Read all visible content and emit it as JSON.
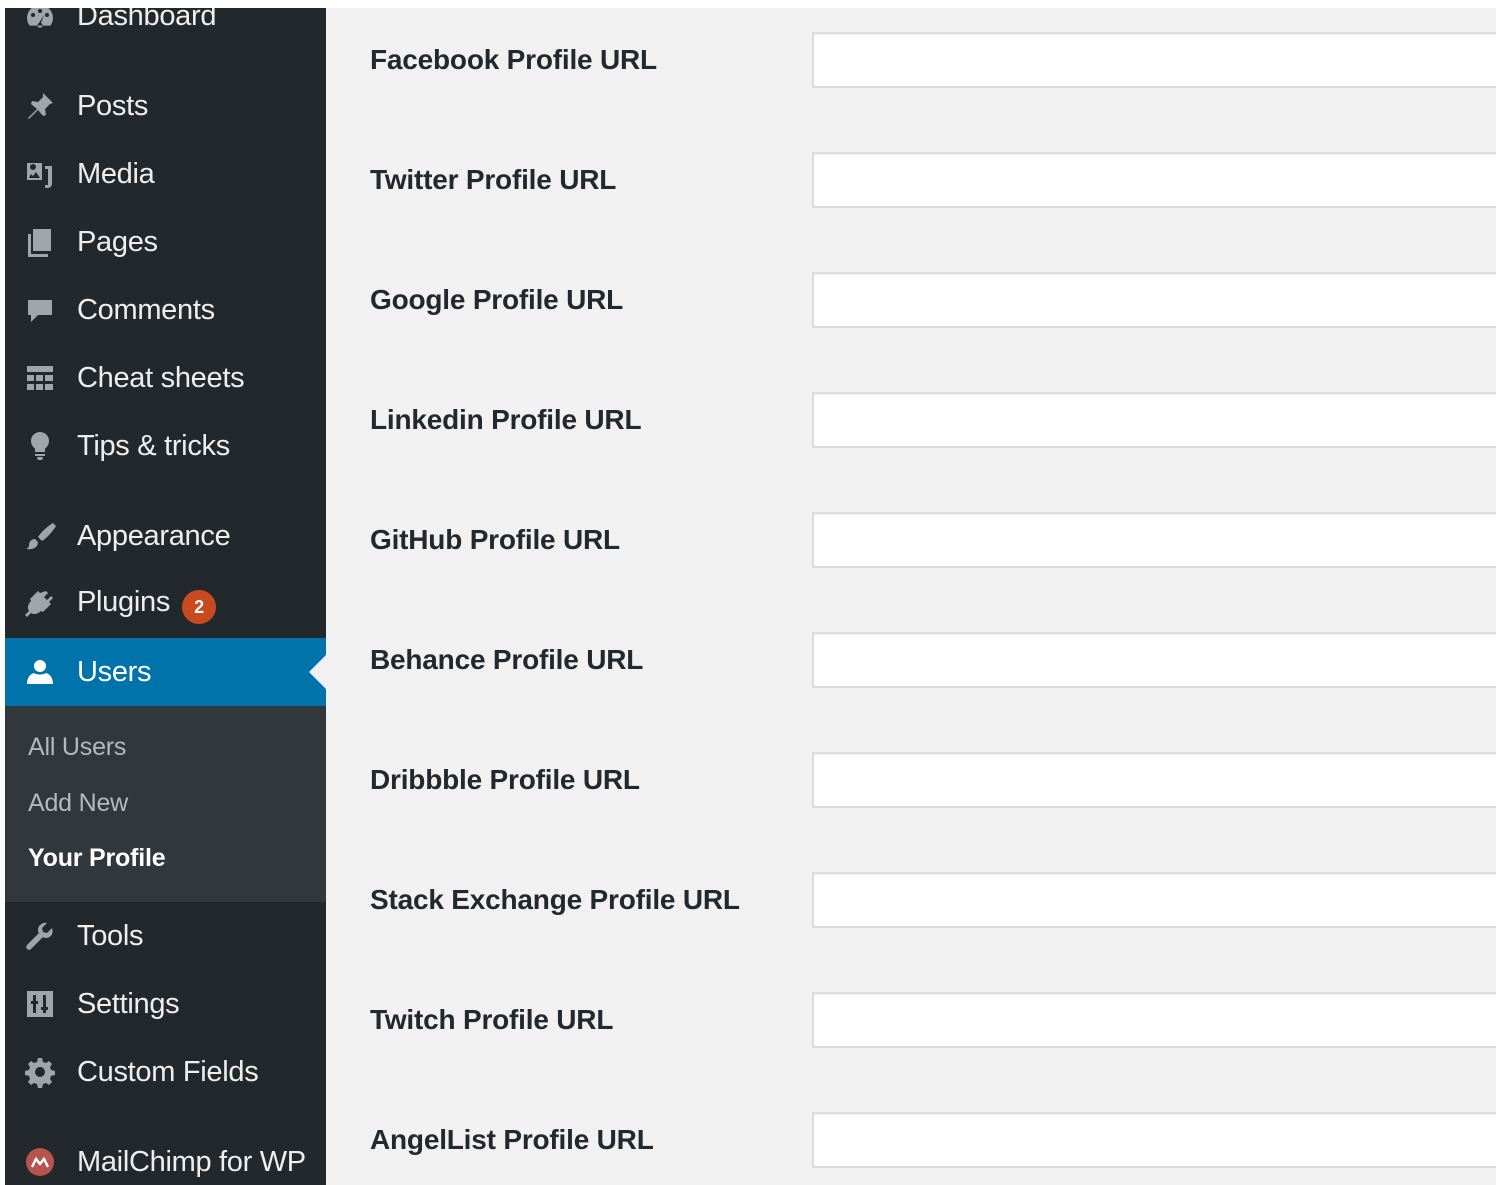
{
  "sidebar": {
    "items": [
      {
        "key": "dashboard",
        "label": "Dashboard",
        "icon": "dashboard-icon"
      },
      {
        "key": "posts",
        "label": "Posts",
        "icon": "pin-icon"
      },
      {
        "key": "media",
        "label": "Media",
        "icon": "media-icon"
      },
      {
        "key": "pages",
        "label": "Pages",
        "icon": "pages-icon"
      },
      {
        "key": "comments",
        "label": "Comments",
        "icon": "comment-icon"
      },
      {
        "key": "cheat-sheets",
        "label": "Cheat sheets",
        "icon": "grid-icon"
      },
      {
        "key": "tips",
        "label": "Tips & tricks",
        "icon": "lightbulb-icon"
      },
      {
        "key": "appearance",
        "label": "Appearance",
        "icon": "paintbrush-icon"
      },
      {
        "key": "plugins",
        "label": "Plugins",
        "icon": "plug-icon",
        "badge": "2"
      },
      {
        "key": "users",
        "label": "Users",
        "icon": "user-icon",
        "active": true
      },
      {
        "key": "tools",
        "label": "Tools",
        "icon": "wrench-icon"
      },
      {
        "key": "settings",
        "label": "Settings",
        "icon": "sliders-icon"
      },
      {
        "key": "custom-fields",
        "label": "Custom Fields",
        "icon": "gear-icon"
      },
      {
        "key": "mailchimp",
        "label": "MailChimp for WP",
        "icon": "mailchimp-icon"
      }
    ],
    "submenu": [
      {
        "label": "All Users"
      },
      {
        "label": "Add New"
      },
      {
        "label": "Your Profile",
        "current": true
      }
    ],
    "colors": {
      "background": "#23282d",
      "active": "#0073aa",
      "submenu": "#32373c",
      "badge": "#ca4a1f"
    }
  },
  "fields": [
    {
      "label": "Facebook Profile URL",
      "value": ""
    },
    {
      "label": "Twitter Profile URL",
      "value": ""
    },
    {
      "label": "Google Profile URL",
      "value": ""
    },
    {
      "label": "Linkedin Profile URL",
      "value": ""
    },
    {
      "label": "GitHub Profile URL",
      "value": ""
    },
    {
      "label": "Behance Profile URL",
      "value": ""
    },
    {
      "label": "Dribbble Profile URL",
      "value": ""
    },
    {
      "label": "Stack Exchange Profile URL",
      "value": ""
    },
    {
      "label": "Twitch Profile URL",
      "value": ""
    },
    {
      "label": "AngelList Profile URL",
      "value": ""
    }
  ]
}
